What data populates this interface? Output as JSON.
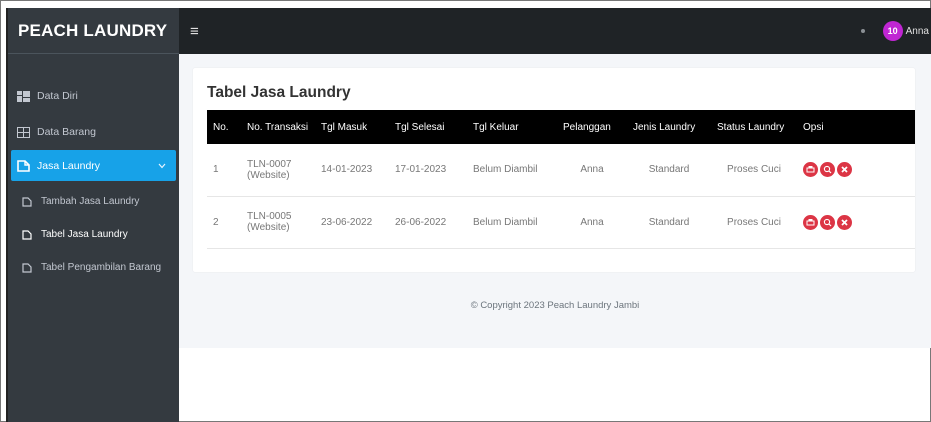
{
  "brand": {
    "title": "PEACH LAUNDRY"
  },
  "topbar": {
    "user_name": "Anna",
    "avatar_text": "10"
  },
  "sidebar": {
    "items": [
      {
        "label": "Data Diri"
      },
      {
        "label": "Data Barang"
      },
      {
        "label": "Jasa Laundry"
      }
    ],
    "sub_items": [
      {
        "label": "Tambah Jasa Laundry"
      },
      {
        "label": "Tabel Jasa Laundry"
      },
      {
        "label": "Tabel Pengambilan Barang"
      }
    ]
  },
  "main": {
    "title": "Tabel Jasa Laundry",
    "columns": [
      "No.",
      "No. Transaksi",
      "Tgl Masuk",
      "Tgl Selesai",
      "Tgl Keluar",
      "Pelanggan",
      "Jenis Laundry",
      "Status Laundry",
      "Opsi"
    ],
    "rows": [
      {
        "no": "1",
        "transaksi": "TLN-0007",
        "transaksi_sub": "(Website)",
        "masuk": "14-01-2023",
        "selesai": "17-01-2023",
        "keluar": "Belum Diambil",
        "pelanggan": "Anna",
        "jenis": "Standard",
        "status": "Proses Cuci"
      },
      {
        "no": "2",
        "transaksi": "TLN-0005",
        "transaksi_sub": "(Website)",
        "masuk": "23-06-2022",
        "selesai": "26-06-2022",
        "keluar": "Belum Diambil",
        "pelanggan": "Anna",
        "jenis": "Standard",
        "status": "Proses Cuci"
      }
    ]
  },
  "footer": {
    "text": "© Copyright 2023 Peach Laundry Jambi"
  },
  "colors": {
    "accent": "#17a2e8",
    "danger": "#dc3545",
    "sidebar": "#343a40"
  }
}
